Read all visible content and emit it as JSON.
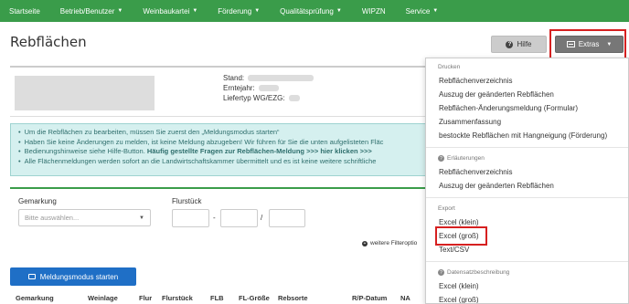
{
  "nav": {
    "items": [
      {
        "label": "Startseite",
        "caret": false
      },
      {
        "label": "Betrieb/Benutzer",
        "caret": true
      },
      {
        "label": "Weinbaukartei",
        "caret": true
      },
      {
        "label": "Förderung",
        "caret": true
      },
      {
        "label": "Qualitätsprüfung",
        "caret": true
      },
      {
        "label": "WIPZN",
        "caret": false
      },
      {
        "label": "Service",
        "caret": true
      }
    ],
    "bg_color": "#3a9c4a"
  },
  "page": {
    "title": "Rebflächen"
  },
  "toolbar": {
    "hilfe_label": "Hilfe",
    "extras_label": "Extras"
  },
  "info": {
    "stand_label": "Stand:",
    "erntejahr_label": "Erntejahr:",
    "liefertyp_label": "Liefertyp WG/EZG:"
  },
  "notice": {
    "line1": "Um die Rebflächen zu bearbeiten, müssen Sie zuerst den „Meldungsmodus starten“",
    "line2": "Haben Sie keine Änderungen zu melden, ist keine Meldung abzugeben! Wir führen für Sie die unten aufgelisteten Fläc",
    "line3_prefix": "Bedienungshinweise siehe Hilfe-Button.",
    "line3_bold": "Häufig gestellte Fragen zur Rebflächen-Meldung >>> hier klicken >>>",
    "line4": "Alle Flächenmeldungen werden sofort an die Landwirtschaftskammer übermittelt und es ist keine weitere schriftliche"
  },
  "filter": {
    "gemarkung_label": "Gemarkung",
    "gemarkung_placeholder": "Bitte auswählen...",
    "flurstueck_label": "Flurstück",
    "dash": "-",
    "slash": "/",
    "more_options": "weitere Filteroptio"
  },
  "actions": {
    "meldung_label": "Meldungsmodus starten"
  },
  "table": {
    "columns": [
      "Gemarkung",
      "Weinlage",
      "Flur",
      "Flurstück",
      "FLB",
      "FL-Größe",
      "Rebsorte",
      "R/P-Datum",
      "NA"
    ]
  },
  "dropdown": {
    "sections": [
      {
        "header": "Drucken",
        "items": [
          "Rebflächenverzeichnis",
          "Auszug der geänderten Rebflächen",
          "Rebflächen-Änderungsmeldung (Formular)",
          "Zusammenfassung",
          "bestockte Rebflächen mit Hangneigung (Förderung)"
        ]
      },
      {
        "header": "Erläuterungen",
        "items": [
          "Rebflächenverzeichnis",
          "Auszug der geänderten Rebflächen"
        ]
      },
      {
        "header": "Export",
        "items": [
          "Excel (klein)",
          "Excel (groß)",
          "Text/CSV"
        ]
      },
      {
        "header": "Datensatzbeschreibung",
        "items": [
          "Excel (klein)",
          "Excel (groß)"
        ]
      }
    ]
  },
  "colors": {
    "accent_green": "#3a9c4a",
    "primary_blue": "#1f6fc6",
    "highlight_red": "#d62020",
    "notice_bg": "#d5f0ef"
  }
}
